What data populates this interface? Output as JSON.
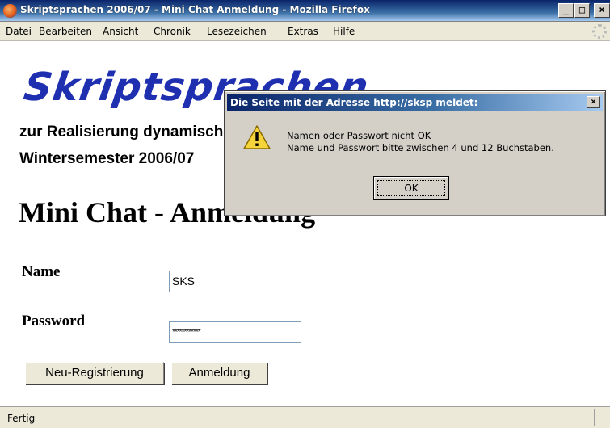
{
  "window": {
    "title": "Skriptsprachen 2006/07 - Mini Chat Anmeldung - Mozilla Firefox",
    "minimize_label": "_",
    "maximize_label": "□",
    "close_label": "×"
  },
  "menu": {
    "items": [
      "Datei",
      "Bearbeiten",
      "Ansicht",
      "Chronik",
      "Lesezeichen",
      "Extras",
      "Hilfe"
    ]
  },
  "page": {
    "logo_text": "Skriptsprachen",
    "subtitle_line1": "zur Realisierung dynamischer Webseiten",
    "subtitle_line2": "Wintersemester 2006/07",
    "heading": "Mini Chat - Anmeldung",
    "name_label": "Name",
    "name_value": "SKS",
    "password_label": "Password",
    "password_mask": "************",
    "register_button": "Neu-Registrierung",
    "login_button": "Anmeldung"
  },
  "status": {
    "text": "Fertig"
  },
  "dialog": {
    "title": "Die Seite mit der Adresse http://sksp meldet:",
    "close_label": "×",
    "message_line1": "Namen oder Passwort nicht OK",
    "message_line2": "Name und Passwort bitte zwischen 4 und 12 Buchstaben.",
    "ok_label": "OK",
    "icon": "warning-icon"
  },
  "colors": {
    "titlebar": "#0a246a",
    "logo": "#1e2fb0",
    "chrome": "#ece9d8",
    "dialog_bg": "#d4d0c8"
  }
}
